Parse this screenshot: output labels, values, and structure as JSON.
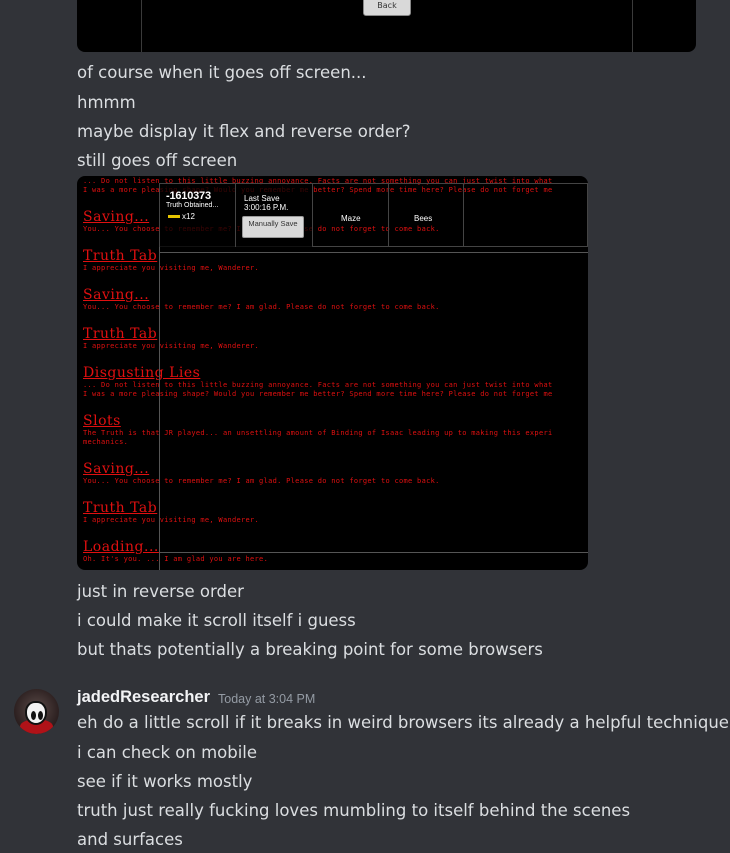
{
  "top_embed": {
    "button_label": "Back"
  },
  "messages_block1": [
    "of course when it goes off screen...",
    "hmmm",
    "maybe display it flex and reverse order?",
    "still goes off screen"
  ],
  "screenshot": {
    "hud": {
      "counter": "-1610373",
      "counter_label": "Truth Obtained...",
      "keys": "x12",
      "save_label": "Last Save",
      "save_time": "3:00:16 P.M.",
      "manual_save": "Manually Save",
      "tabs": [
        "Maze",
        "Bees"
      ]
    },
    "log": [
      {
        "title": "",
        "body": [
          "... Do not listen to this little buzzing annoyance. Facts are not something you can just twist into what",
          "I was a more pleasing shape? Would you remember me better? Spend more time here? Please do not forget me"
        ]
      },
      {
        "title": "Saving...",
        "body": [
          "You... You choose to remember me? I am glad. Please do not forget to come back."
        ]
      },
      {
        "title": "Truth Tab",
        "body": [
          "I appreciate you visiting me, Wanderer."
        ]
      },
      {
        "title": "Saving...",
        "body": [
          "You... You choose to remember me? I am glad. Please do not forget to come back."
        ]
      },
      {
        "title": "Truth Tab",
        "body": [
          "I appreciate you visiting me, Wanderer."
        ]
      },
      {
        "title": "Disgusting Lies",
        "body": [
          "... Do not listen to this little buzzing annoyance. Facts are not something you can just twist into what",
          "I was a more pleasing shape? Would you remember me better? Spend more time here? Please do not forget me"
        ]
      },
      {
        "title": "Slots",
        "body": [
          "The Truth is that JR played... an unsettling amount of Binding of Isaac leading up to making this experi",
          "mechanics."
        ]
      },
      {
        "title": "Saving...",
        "body": [
          "You... You choose to remember me? I am glad. Please do not forget to come back."
        ]
      },
      {
        "title": "Truth Tab",
        "body": [
          "I appreciate you visiting me, Wanderer."
        ]
      },
      {
        "title": "Loading...",
        "body": [
          "Oh. It's you. ... I am glad you are here."
        ]
      }
    ]
  },
  "messages_block2": [
    "just in reverse order",
    "i could make it scroll itself i guess",
    "but thats potentially a breaking point for some browsers"
  ],
  "author": {
    "username": "jadedResearcher",
    "timestamp": "Today at 3:04 PM"
  },
  "messages_block3": [
    "eh do a little scroll if it breaks in weird browsers its already a helpful technique",
    "i can check on mobile",
    "see if it works mostly",
    "truth just really fucking loves mumbling to itself behind the scenes",
    "and surfaces"
  ],
  "colors": {
    "bg": "#313338",
    "text": "#dbdee1",
    "log_red": "#e01010"
  }
}
